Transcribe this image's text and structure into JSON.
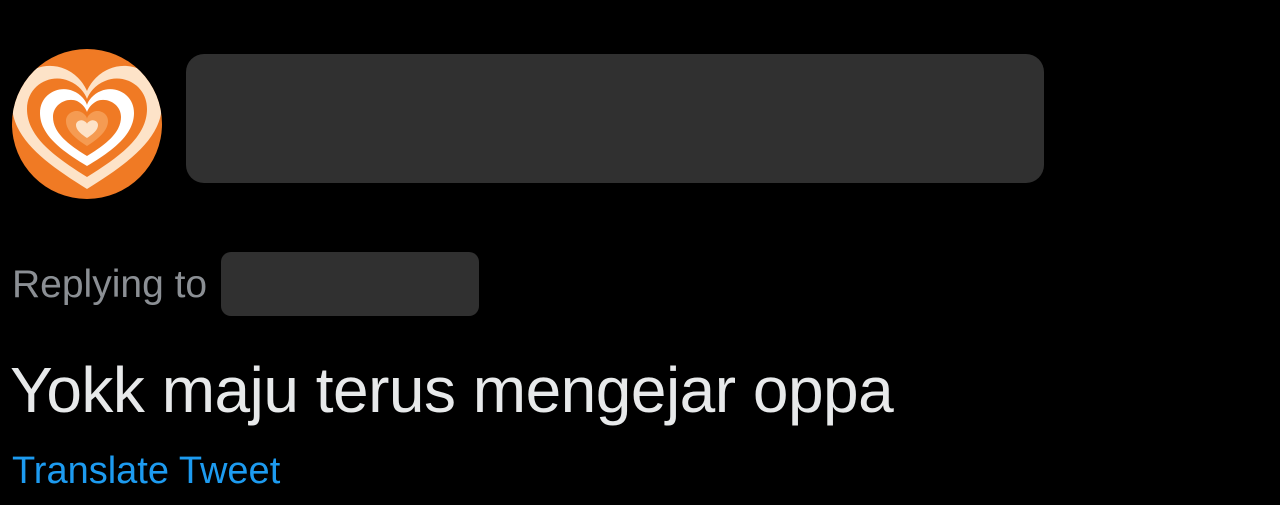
{
  "tweet": {
    "avatar_icon": "concentric-heart-avatar-icon",
    "avatar_colors": [
      "#f07a24",
      "#ffffff",
      "#f59b52",
      "#fde3c8"
    ],
    "display_name_redacted": true,
    "reply_label": "Replying to",
    "reply_handle_redacted": true,
    "text": "Yokk maju terus mengejar oppa",
    "translate_link": "Translate Tweet"
  },
  "colors": {
    "background": "#000000",
    "redaction": "#303030",
    "secondary_text": "#8b8f94",
    "primary_text": "#e7e9ea",
    "link": "#1d9bf0"
  }
}
